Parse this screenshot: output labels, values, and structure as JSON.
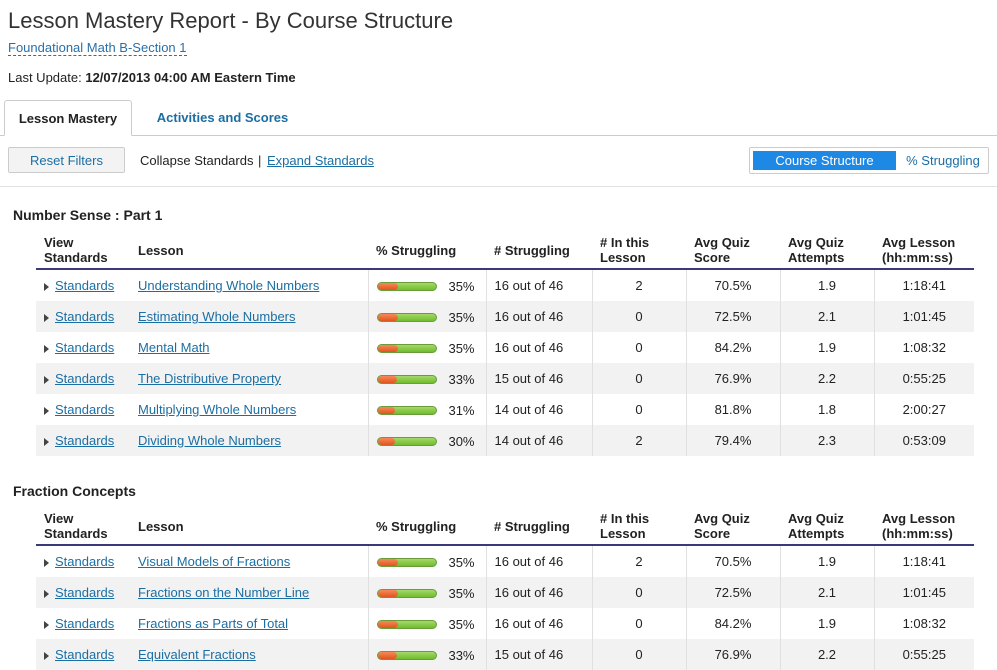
{
  "header": {
    "title": "Lesson Mastery Report - By Course Structure",
    "course_link": "Foundational Math B-Section 1",
    "last_update_label": "Last Update:",
    "last_update_value": "12/07/2013 04:00 AM Eastern Time"
  },
  "tabs": {
    "active": "Lesson Mastery",
    "inactive": "Activities and Scores"
  },
  "toolbar": {
    "reset_filters": "Reset Filters",
    "collapse_standards": "Collapse Standards",
    "separator": "|",
    "expand_standards": "Expand Standards",
    "view_toggle_active": "Course Structure",
    "view_toggle_inactive": "% Struggling"
  },
  "columns": {
    "view_standards_1": "View",
    "view_standards_2": "Standards",
    "lesson": "Lesson",
    "pct_struggling": "% Struggling",
    "num_struggling": "# Struggling",
    "in_lesson_1": "# In this",
    "in_lesson_2": "Lesson",
    "avg_quiz_score_1": "Avg Quiz",
    "avg_quiz_score_2": "Score",
    "avg_quiz_attempts_1": "Avg Quiz",
    "avg_quiz_attempts_2": "Attempts",
    "avg_lesson_1": "Avg Lesson",
    "avg_lesson_2": "(hh:mm:ss)"
  },
  "sections": [
    {
      "title": "Number Sense : Part 1",
      "rows": [
        {
          "standards": "Standards",
          "lesson": "Understanding Whole Numbers",
          "pct": "35%",
          "pct_value": 0.35,
          "struggling": "16 out of 46",
          "in_lesson": "2",
          "score": "70.5%",
          "attempts": "1.9",
          "time": "1:18:41"
        },
        {
          "standards": "Standards",
          "lesson": "Estimating Whole Numbers",
          "pct": "35%",
          "pct_value": 0.35,
          "struggling": "16 out of 46",
          "in_lesson": "0",
          "score": "72.5%",
          "attempts": "2.1",
          "time": "1:01:45"
        },
        {
          "standards": "Standards",
          "lesson": "Mental Math",
          "pct": "35%",
          "pct_value": 0.35,
          "struggling": "16 out of 46",
          "in_lesson": "0",
          "score": "84.2%",
          "attempts": "1.9",
          "time": "1:08:32"
        },
        {
          "standards": "Standards",
          "lesson": "The Distributive Property",
          "pct": "33%",
          "pct_value": 0.33,
          "struggling": "15 out of 46",
          "in_lesson": "0",
          "score": "76.9%",
          "attempts": "2.2",
          "time": "0:55:25"
        },
        {
          "standards": "Standards",
          "lesson": "Multiplying Whole Numbers",
          "pct": "31%",
          "pct_value": 0.31,
          "struggling": "14 out of 46",
          "in_lesson": "0",
          "score": "81.8%",
          "attempts": "1.8",
          "time": "2:00:27"
        },
        {
          "standards": "Standards",
          "lesson": "Dividing Whole Numbers",
          "pct": "30%",
          "pct_value": 0.3,
          "struggling": "14 out of 46",
          "in_lesson": "2",
          "score": "79.4%",
          "attempts": "2.3",
          "time": "0:53:09"
        }
      ]
    },
    {
      "title": "Fraction Concepts",
      "rows": [
        {
          "standards": "Standards",
          "lesson": "Visual Models of Fractions",
          "pct": "35%",
          "pct_value": 0.35,
          "struggling": "16 out of 46",
          "in_lesson": "2",
          "score": "70.5%",
          "attempts": "1.9",
          "time": "1:18:41"
        },
        {
          "standards": "Standards",
          "lesson": "Fractions on the Number Line",
          "pct": "35%",
          "pct_value": 0.35,
          "struggling": "16 out of 46",
          "in_lesson": "0",
          "score": "72.5%",
          "attempts": "2.1",
          "time": "1:01:45"
        },
        {
          "standards": "Standards",
          "lesson": "Fractions as Parts of Total",
          "pct": "35%",
          "pct_value": 0.35,
          "struggling": "16 out of 46",
          "in_lesson": "0",
          "score": "84.2%",
          "attempts": "1.9",
          "time": "1:08:32"
        },
        {
          "standards": "Standards",
          "lesson": "Equivalent Fractions",
          "pct": "33%",
          "pct_value": 0.33,
          "struggling": "15 out of 46",
          "in_lesson": "0",
          "score": "76.9%",
          "attempts": "2.2",
          "time": "0:55:25"
        }
      ]
    }
  ]
}
